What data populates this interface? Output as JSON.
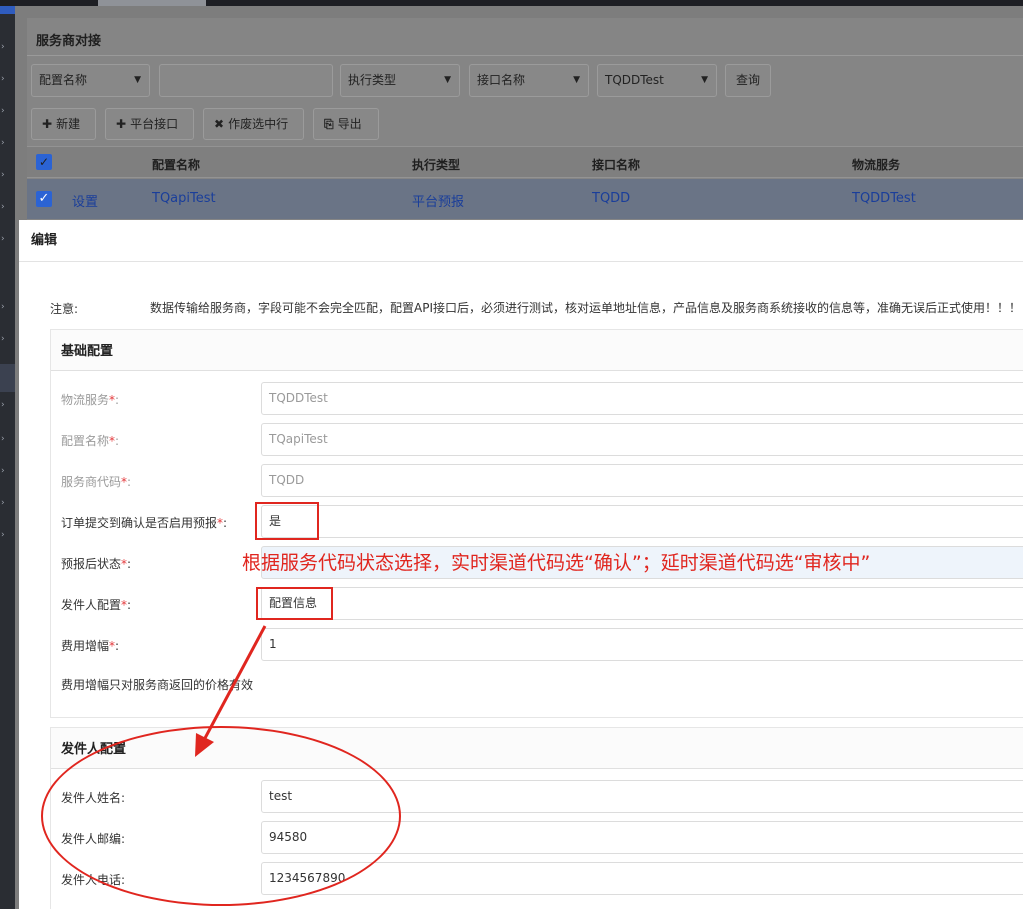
{
  "page": {
    "title": "服务商对接"
  },
  "filters": {
    "config_name": "配置名称",
    "search_value": "",
    "exec_type": "执行类型",
    "api_name": "接口名称",
    "logistics": "TQDDTest",
    "query_button": "查询"
  },
  "toolbar": {
    "new_label": "新建",
    "platform_api_label": "平台接口",
    "void_label": "作废选中行",
    "export_label": "导出"
  },
  "table": {
    "columns": [
      "配置名称",
      "执行类型",
      "接口名称",
      "物流服务"
    ],
    "row": {
      "action": "设置",
      "config_name": "TQapiTest",
      "exec_type": "平台预报",
      "api_name": "TQDD",
      "logistics": "TQDDTest"
    }
  },
  "modal": {
    "title": "编辑",
    "notice_label": "注意:",
    "notice_text": "数据传输给服务商，字段可能不会完全匹配，配置API接口后，必须进行测试，核对运单地址信息，产品信息及服务商系统接收的信息等，准确无误后正式使用！！！",
    "basic_section": {
      "title": "基础配置",
      "fields": [
        {
          "label": "物流服务",
          "value": "TQDDTest"
        },
        {
          "label": "配置名称",
          "value": "TQapiTest"
        },
        {
          "label": "服务商代码",
          "value": "TQDD"
        },
        {
          "label": "订单提交到确认是否启用预报",
          "value": "是"
        },
        {
          "label": "预报后状态",
          "value": ""
        },
        {
          "label": "发件人配置",
          "value": "配置信息"
        },
        {
          "label": "费用增幅",
          "value": "1"
        }
      ],
      "hint": "费用增幅只对服务商返回的价格有效"
    },
    "sender_section": {
      "title": "发件人配置",
      "fields": [
        {
          "label": "发件人姓名",
          "value": "test"
        },
        {
          "label": "发件人邮编",
          "value": "94580"
        },
        {
          "label": "发件人电话",
          "value": "1234567890"
        }
      ]
    }
  },
  "annotation": {
    "text": "根据服务代码状态选择，实时渠道代码选“确认”；延时渠道代码选“审核中”",
    "color": "#e0261f"
  }
}
